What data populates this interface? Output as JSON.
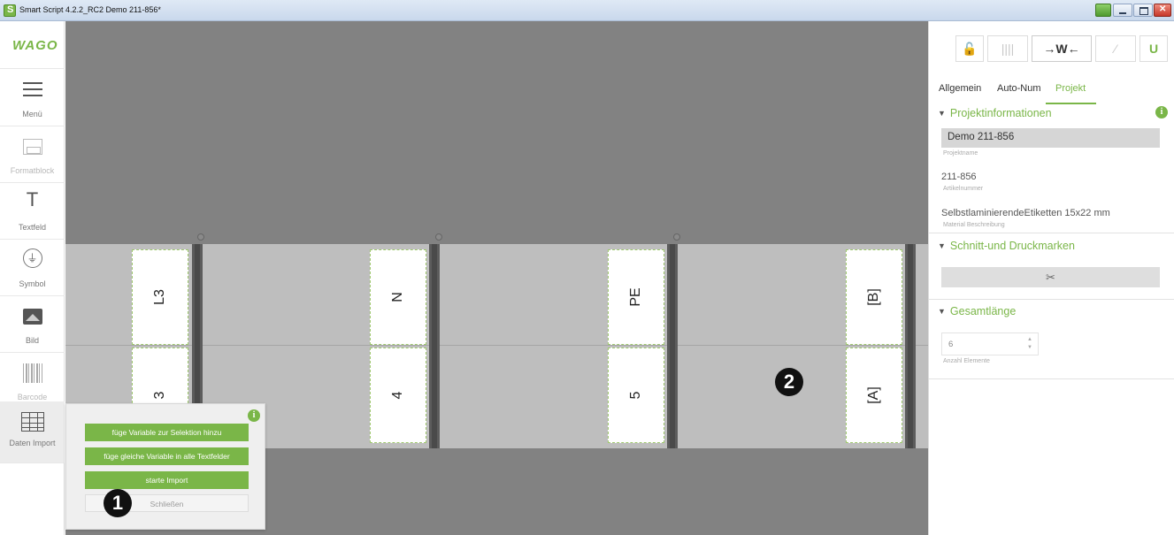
{
  "window": {
    "title": "Smart Script 4.2.2_RC2  Demo 211-856*"
  },
  "sidebar": {
    "logo": "WAGO",
    "items": [
      {
        "label": "Menü"
      },
      {
        "label": "Formatblock"
      },
      {
        "label": "Textfeld",
        "icon_text": "T"
      },
      {
        "label": "Symbol"
      },
      {
        "label": "Bild"
      },
      {
        "label": "Barcode"
      },
      {
        "label": "Daten Import"
      }
    ]
  },
  "canvas": {
    "top_row": [
      "L3",
      "N",
      "PE",
      "[B]"
    ],
    "bottom_row": [
      "3",
      "4",
      "5",
      "[A]"
    ]
  },
  "import_popup": {
    "info_icon": "i",
    "buttons": [
      "füge Variable zur Selektion hinzu",
      "füge gleiche Variable in alle Textfelder",
      "starte Import"
    ],
    "close_label": "Schließen"
  },
  "badges": [
    "1",
    "2"
  ],
  "right_panel": {
    "toolbar": {
      "align_label": "→W←"
    },
    "tabs": [
      "Allgemein",
      "Auto-Num",
      "Projekt"
    ],
    "active_tab": "Projekt",
    "sections": {
      "projektinformationen": {
        "title": "Projektinformationen",
        "info_icon": "i",
        "project_name": {
          "value": "Demo 211-856",
          "label": "Projektname"
        },
        "article_number": {
          "value": "211-856",
          "label": "Artikelnummer"
        },
        "material": {
          "value": "SelbstlaminierendeEtiketten 15x22 mm",
          "label": "Material Beschreibung"
        }
      },
      "schnitt": {
        "title": "Schnitt-und Druckmarken",
        "button_icon": "✂"
      },
      "gesamtlaenge": {
        "title": "Gesamtlänge",
        "count_value": "6",
        "count_label": "Anzahl Elemente"
      }
    }
  },
  "colors": {
    "accent": "#7ab648",
    "canvas_bg": "#828282",
    "strip_bg": "#bebebe"
  }
}
